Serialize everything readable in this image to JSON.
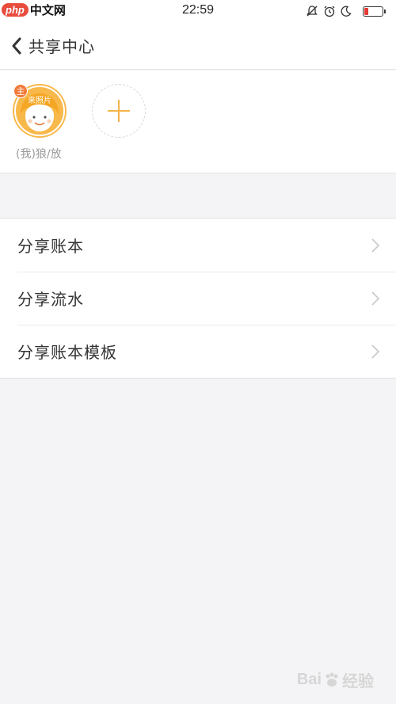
{
  "status_bar": {
    "time": "22:59",
    "watermark_logo": "php",
    "watermark_text": "中文网",
    "battery_level": 0.2,
    "icons": [
      "mute-bell-icon",
      "alarm-icon",
      "moon-icon",
      "battery-icon"
    ]
  },
  "nav": {
    "title": "共享中心",
    "back_icon": "chevron-left-icon"
  },
  "members": {
    "owner_badge": "主",
    "owner_avatar_caption": "来照片",
    "owner_name": "(我)狼/放",
    "add_icon": "plus-icon"
  },
  "menu": {
    "items": [
      {
        "label": "分享账本"
      },
      {
        "label": "分享流水"
      },
      {
        "label": "分享账本模板"
      }
    ],
    "chevron_icon": "chevron-right-icon"
  },
  "watermark": {
    "brand": "Bai",
    "brand_cn": "经验"
  },
  "colors": {
    "accent": "#f8b84a",
    "badge": "#f07a3a",
    "background": "#f4f4f6",
    "battery_low": "#e53935"
  }
}
